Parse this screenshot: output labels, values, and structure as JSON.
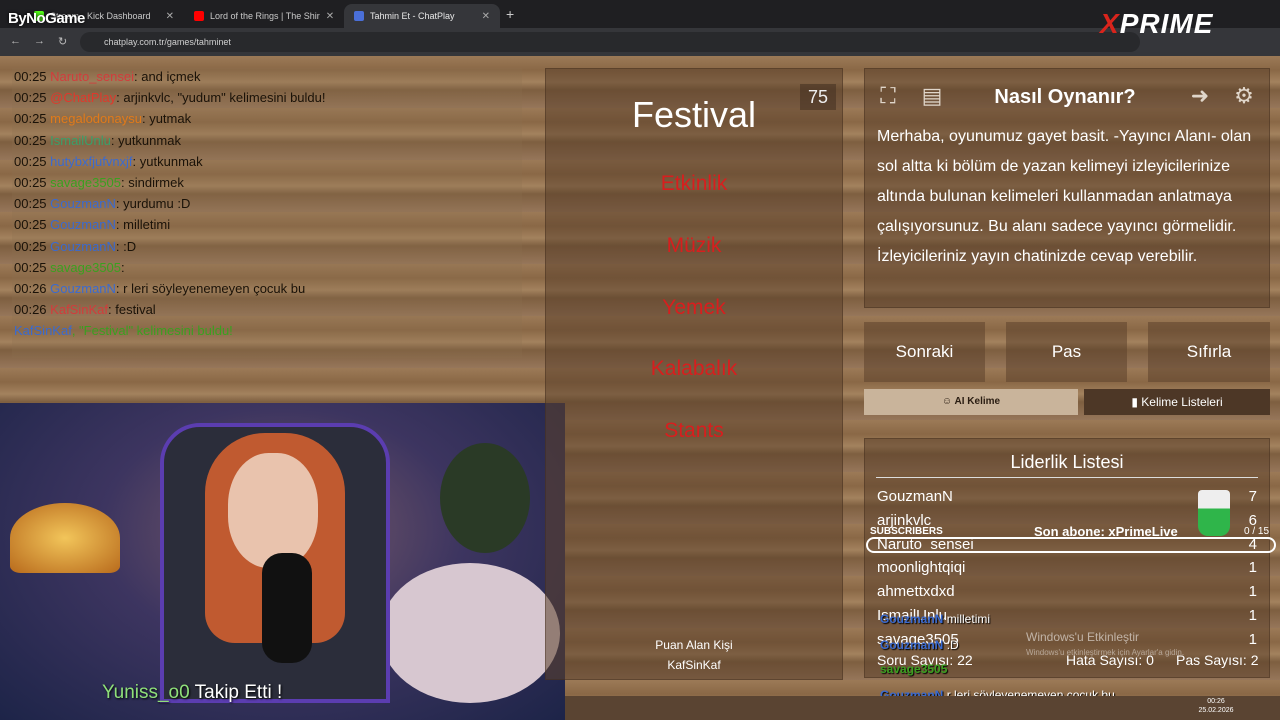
{
  "browser": {
    "tabs": [
      {
        "label": "Stream - Kick Dashboard"
      },
      {
        "label": "Lord of the Rings | The Shir"
      },
      {
        "label": "Tahmin Et - ChatPlay"
      }
    ],
    "url": "chatplay.com.tr/games/tahminet"
  },
  "overlay": {
    "bynogame": "ByNoGame",
    "xprime_x": "X",
    "xprime_rest": "PRIME"
  },
  "chat": [
    {
      "time": "00:25",
      "user": "Naruto_sensei",
      "color": "#d23c3c",
      "msg": ": and içmek"
    },
    {
      "time": "00:25",
      "user": "@ChatPlay",
      "color": "#e0382c",
      "msg": ": arjinkvlc, \"yudum\" kelimesini buldu!"
    },
    {
      "time": "00:25",
      "user": "megalodonaysu",
      "color": "#e07a1a",
      "msg": ": yutmak"
    },
    {
      "time": "00:25",
      "user": "IsmailUnlu",
      "color": "#3aa06a",
      "msg": ": yutkunmak"
    },
    {
      "time": "00:25",
      "user": "hutybxfjufvnxjf",
      "color": "#3a6ad0",
      "msg": ": yutkunmak"
    },
    {
      "time": "00:25",
      "user": "savage3505",
      "color": "#3aa020",
      "msg": ": sindirmek"
    },
    {
      "time": "00:25",
      "user": "GouzmanN",
      "color": "#3a6ad0",
      "msg": ": yurdumu :D"
    },
    {
      "time": "00:25",
      "user": "GouzmanN",
      "color": "#3a6ad0",
      "msg": ": milletimi"
    },
    {
      "time": "00:25",
      "user": "GouzmanN",
      "color": "#3a6ad0",
      "msg": ": :D"
    },
    {
      "time": "00:25",
      "user": "savage3505",
      "color": "#3aa020",
      "msg": ": "
    },
    {
      "time": "00:26",
      "user": "GouzmanN",
      "color": "#3a6ad0",
      "msg": ": r leri söyleyenemeyen çocuk bu"
    },
    {
      "time": "00:26",
      "user": "KafSinKaf",
      "color": "#d23c3c",
      "msg": ": festival"
    }
  ],
  "chat_system": {
    "user": "KafSinKaf",
    "msg": ", \"Festival\" kelimesini buldu!"
  },
  "game": {
    "timer": "75",
    "word": "Festival",
    "forbidden": [
      "Etkinlik",
      "Müzik",
      "Yemek",
      "Kalabalık",
      "Stants"
    ],
    "scorer_label": "Puan Alan Kişi",
    "scorer_name": "KafSinKaf"
  },
  "howto": {
    "title": "Nasıl Oynanır?",
    "text": "Merhaba, oyunumuz gayet basit. -Yayıncı Alanı- olan sol altta ki bölüm de yazan kelimeyi izleyicilerinize altında bulunan kelimeleri kullanmadan anlatmaya çalışıyorsunuz. Bu alanı sadece yayıncı görmelidir. İzleyicileriniz yayın chatinizde cevap verebilir."
  },
  "actions": {
    "next": "Sonraki",
    "pass": "Pas",
    "reset": "Sıfırla",
    "ai_word": "AI Kelime",
    "word_lists": "Kelime Listeleri"
  },
  "leaderboard": {
    "title": "Liderlik Listesi",
    "rows": [
      {
        "name": "GouzmanN",
        "points": "7"
      },
      {
        "name": "arjinkvlc",
        "points": "6"
      },
      {
        "name": "Naruto_sensei",
        "points": "4"
      },
      {
        "name": "moonlightqiqi",
        "points": "1"
      },
      {
        "name": "ahmettxdxd",
        "points": "1"
      },
      {
        "name": "IsmailUnlu",
        "points": "1"
      },
      {
        "name": "savage3505",
        "points": "1"
      }
    ],
    "questions": "Soru Sayısı: 22",
    "errors": "Hata Sayısı: 0",
    "passes": "Pas Sayısı: 2"
  },
  "subs": {
    "label": "SUBSCRIBERS",
    "last": "Son abone: xPrimeLive",
    "count": "0 / 15"
  },
  "overlay_chat": [
    {
      "user": "GouzmanN",
      "msg": "milletimi"
    },
    {
      "user": "GouzmanN",
      "msg": ":D"
    },
    {
      "user": "savage3505",
      "msg": ""
    },
    {
      "user": "GouzmanN",
      "msg": "r leri söyleyenemeyen çocuk bu"
    }
  ],
  "follow": {
    "name": "Yuniss_o0",
    "text": " Takip Etti !"
  },
  "watermark": {
    "title": "Windows'u Etkinleştir",
    "sub": "Windows'u etkinleştirmek için Ayarlar'a gidin."
  },
  "clock": {
    "time": "00:26",
    "date": "25.02.2026"
  }
}
